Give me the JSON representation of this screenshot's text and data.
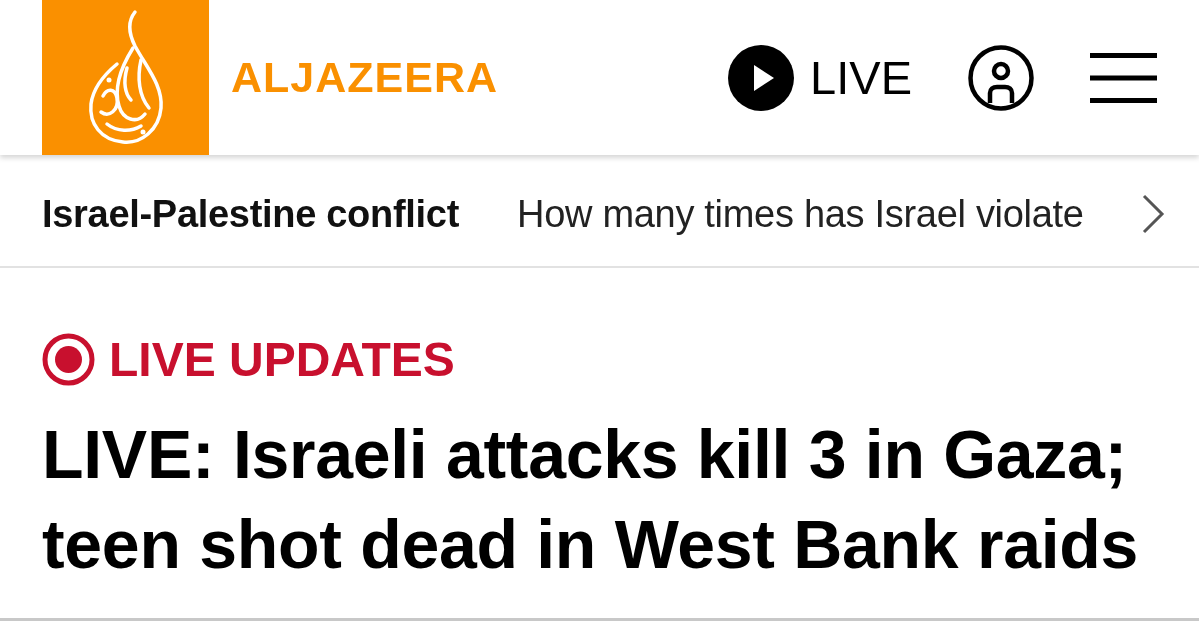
{
  "header": {
    "brand": "ALJAZEERA",
    "live_button": {
      "label": "LIVE"
    }
  },
  "topic_bar": {
    "topic": "Israel-Palestine conflict",
    "headline": "How many times has Israel violate"
  },
  "article": {
    "badge": "LIVE UPDATES",
    "title": "LIVE: Israeli attacks kill 3 in Gaza; teen shot dead in West Bank raids"
  }
}
